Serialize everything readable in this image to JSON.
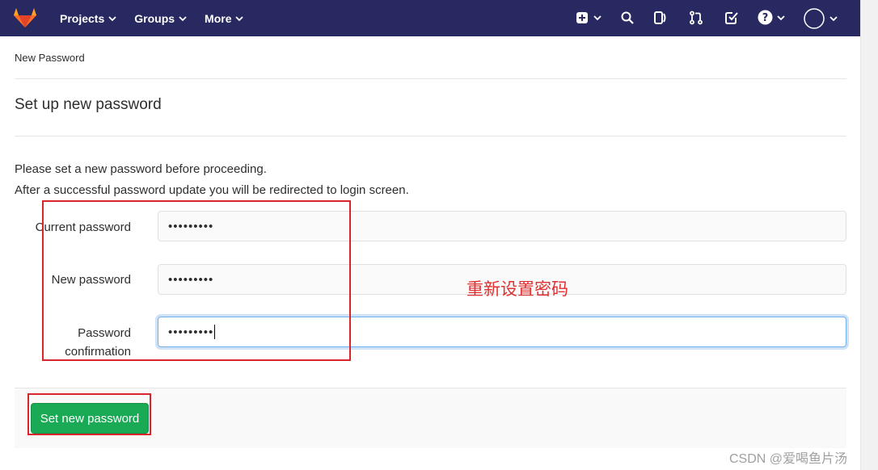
{
  "nav": {
    "projects_label": "Projects",
    "groups_label": "Groups",
    "more_label": "More"
  },
  "breadcrumb": "New Password",
  "page_title": "Set up new password",
  "description": {
    "line1": "Please set a new password before proceeding.",
    "line2": "After a successful password update you will be redirected to login screen."
  },
  "form": {
    "current_password_label": "Current password",
    "current_password_value": "•••••••••",
    "new_password_label": "New password",
    "new_password_value": "•••••••••",
    "confirmation_label_line1": "Password",
    "confirmation_label_line2": "confirmation",
    "confirmation_value": "•••••••••",
    "submit_label": "Set new password"
  },
  "annotation": {
    "text": "重新设置密码",
    "color": "#d9262c"
  },
  "watermark": "CSDN @爱喝鱼片汤",
  "colors": {
    "topbar": "#292961",
    "primary_button": "#1aaa55"
  }
}
